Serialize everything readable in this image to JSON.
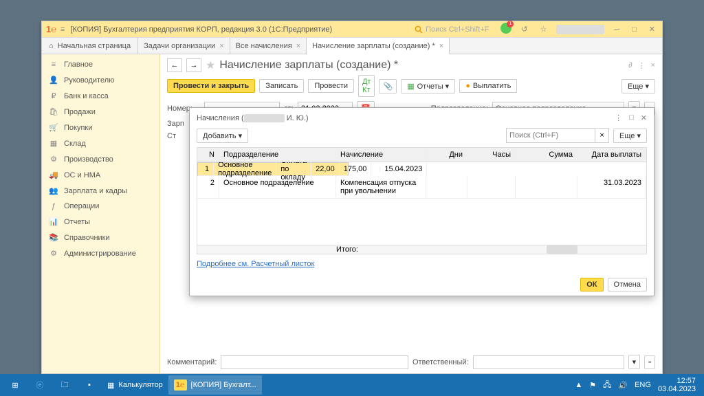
{
  "titlebar": {
    "title": "[КОПИЯ] Бухгалтерия предприятия КОРП, редакция 3.0  (1С:Предприятие)",
    "search_ph": "Поиск Ctrl+Shift+F",
    "bell_badge": "1"
  },
  "tabs": {
    "home": "Начальная страница",
    "t1": "Задачи организации",
    "t2": "Все начисления",
    "t3": "Начисление зарплаты (создание) *"
  },
  "sidebar": [
    {
      "icon": "≡",
      "label": "Главное"
    },
    {
      "icon": "👤",
      "label": "Руководителю"
    },
    {
      "icon": "₽",
      "label": "Банк и касса"
    },
    {
      "icon": "🛍",
      "label": "Продажи"
    },
    {
      "icon": "🛒",
      "label": "Покупки"
    },
    {
      "icon": "▦",
      "label": "Склад"
    },
    {
      "icon": "⚙",
      "label": "Производство"
    },
    {
      "icon": "🚚",
      "label": "ОС и НМА"
    },
    {
      "icon": "👥",
      "label": "Зарплата и кадры"
    },
    {
      "icon": "ƒ",
      "label": "Операции"
    },
    {
      "icon": "📊",
      "label": "Отчеты"
    },
    {
      "icon": "📚",
      "label": "Справочники"
    },
    {
      "icon": "⚙",
      "label": "Администрирование"
    }
  ],
  "main": {
    "title": "Начисление зарплаты (создание) *",
    "btn_post_close": "Провести и закрыть",
    "btn_save": "Записать",
    "btn_post": "Провести",
    "btn_reports": "Отчеты ▾",
    "btn_pay": "Выплатить",
    "btn_more": "Еще ▾",
    "lbl_nomer": "Номер:",
    "lbl_ot": "от:",
    "date": "31.03.2023",
    "lbl_podr": "Подразделение:",
    "podr": "Основное подразделение",
    "lbl_zarp": "Зарп",
    "lbl_st": "Ст",
    "lbl_comment": "Комментарий:",
    "lbl_resp": "Ответственный:"
  },
  "dialog": {
    "title_pre": "Начисления (",
    "title_person": "И. Ю.)",
    "btn_add": "Добавить ▾",
    "search_ph": "Поиск (Ctrl+F)",
    "btn_more": "Еще ▾",
    "th": {
      "n": "N",
      "pod": "Подразделение",
      "nach": "Начисление",
      "dni": "Дни",
      "chas": "Часы",
      "sum": "Сумма",
      "date": "Дата выплаты"
    },
    "rows": [
      {
        "n": "1",
        "pod": "Основное подразделение",
        "nach": "Оплата по окладу",
        "dni": "22,00",
        "chas": "175,00",
        "sum": "",
        "date": "15.04.2023"
      },
      {
        "n": "2",
        "pod": "Основное подразделение",
        "nach": "Компенсация отпуска при увольнении",
        "dni": "",
        "chas": "",
        "sum": "",
        "date": "31.03.2023"
      }
    ],
    "itogo": "Итого:",
    "link": "Подробнее см. Расчетный листок",
    "ok": "ОК",
    "cancel": "Отмена"
  },
  "taskbar": {
    "app1": "Калькулятор",
    "app2": "[КОПИЯ] Бухгалт...",
    "lang": "ENG",
    "time": "12:57",
    "date": "03.04.2023"
  }
}
